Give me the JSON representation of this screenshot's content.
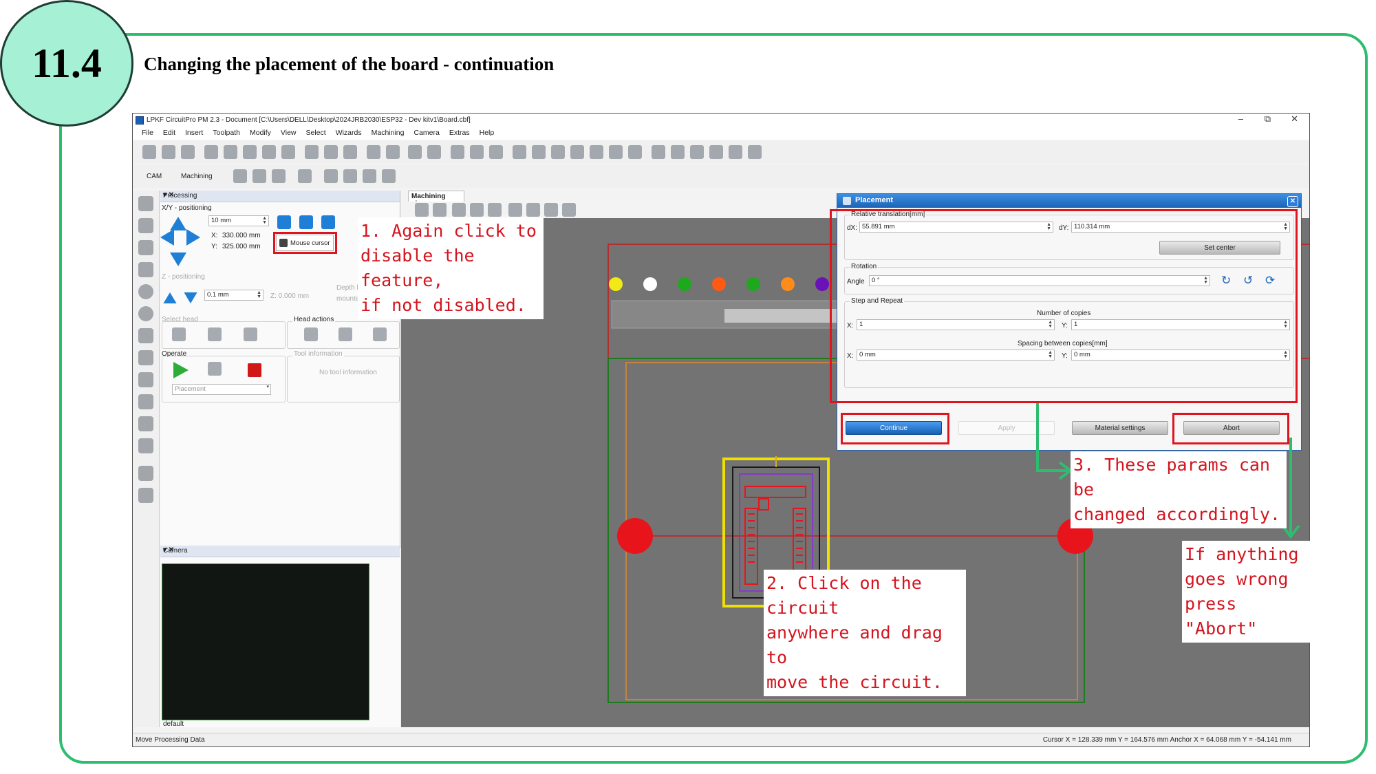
{
  "slide": {
    "section_number": "11.4",
    "title": "Changing the placement of the board - continuation"
  },
  "window": {
    "title": "LPKF CircuitPro PM 2.3 - Document [C:\\Users\\DELL\\Desktop\\2024JRB2030\\ESP32 - Dev kitv1\\Board.cbf]",
    "controls": {
      "minimize": "–",
      "maximize": "⧉",
      "close": "✕"
    }
  },
  "menu": [
    "File",
    "Edit",
    "Insert",
    "Toolpath",
    "Modify",
    "View",
    "Select",
    "Wizards",
    "Machining",
    "Camera",
    "Extras",
    "Help"
  ],
  "toolbar2": {
    "cam_label": "CAM",
    "machining_label": "Machining"
  },
  "processing_panel": {
    "header": "Processing",
    "xy_label": "X/Y - positioning",
    "step_value": "10 mm",
    "x_label": "X:",
    "x_value": "330.000 mm",
    "y_label": "Y:",
    "y_value": "325.000 mm",
    "mouse_cursor_label": "Mouse cursor",
    "z_label": "Z - positioning",
    "z_step": "0.1 mm",
    "z_value": "Z: 0.000 mm",
    "depth_limiter": "Depth limiter",
    "depth_mounted": "mounted",
    "select_head": "Select head",
    "head_actions": "Head actions",
    "operate": "Operate",
    "tool_info_label": "Tool information",
    "no_tool_info": "No tool information",
    "operate_select": "Placement"
  },
  "camera_panel": {
    "header": "Camera",
    "footer": "default"
  },
  "machining_tab": "Machining view",
  "dialog": {
    "title": "Placement",
    "relative_translation": "Relative translation[mm]",
    "dx_label": "dX:",
    "dx_value": "55.891 mm",
    "dy_label": "dY:",
    "dy_value": "110.314 mm",
    "set_center": "Set center",
    "rotation": "Rotation",
    "angle_label": "Angle",
    "angle_value": "0 °",
    "step_repeat": "Step and Repeat",
    "number_of_copies": "Number of copies",
    "copies_x_label": "X:",
    "copies_x": "1",
    "copies_y_label": "Y:",
    "copies_y": "1",
    "spacing_label": "Spacing between copies[mm]",
    "spacing_x_label": "X:",
    "spacing_x": "0 mm",
    "spacing_y_label": "Y:",
    "spacing_y": "0 mm",
    "btn_continue": "Continue",
    "btn_apply": "Apply",
    "btn_material": "Material settings",
    "btn_abort": "Abort"
  },
  "annotations": {
    "a1": "1. Again click to\ndisable the feature,\nif not disabled.",
    "a2": "2. Click on the circuit\nanywhere and drag to\nmove the circuit.",
    "a3": "3. These params can be\nchanged accordingly.",
    "a4": "If anything\ngoes wrong\npress \"Abort\""
  },
  "statusbar": {
    "message": "Move Processing Data",
    "coords": "Cursor X =  128.339 mm   Y =  164.576 mm        Anchor X =  64.068 mm   Y =  -54.141 mm"
  },
  "colors": {
    "frame": "#2dbd6e",
    "badge": "#a6f0d6",
    "annotation": "#d4141e",
    "fiducial": "#e8141c",
    "selection": "#f0e000",
    "layer_dots": [
      "#f2ea16",
      "#ffffff",
      "#1ea81e",
      "#ff5a14",
      "#1ea81e",
      "#ff8c1a",
      "#6a12b8"
    ]
  }
}
